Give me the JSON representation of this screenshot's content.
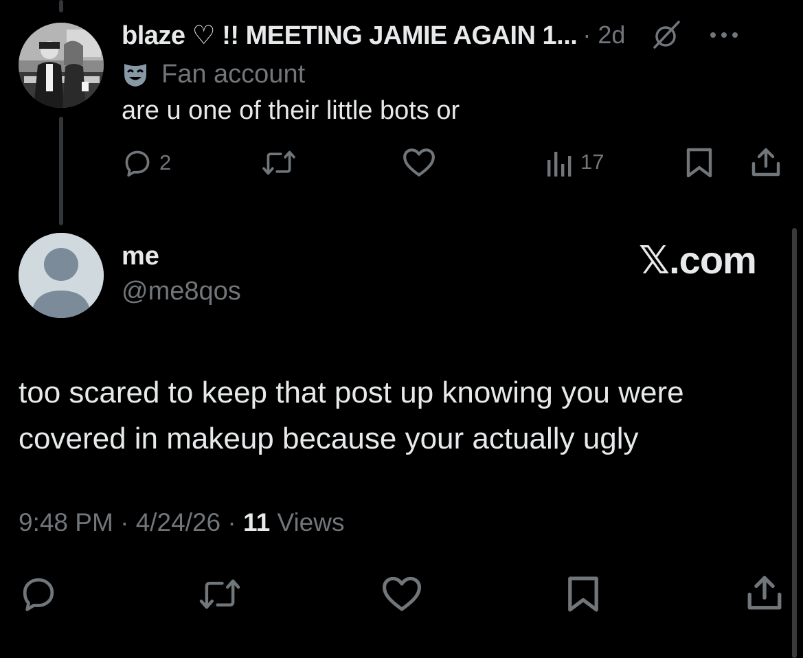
{
  "reply": {
    "display_name": "blaze ♡ !! MEETING JAMIE AGAIN 1...",
    "separator": "·",
    "time_ago": "2d",
    "label_icon": "theater-mask-icon",
    "label": "Fan account",
    "text": "are u one of their little bots or",
    "actions": {
      "reply_count": "2",
      "repost_count": "",
      "like_count": "",
      "views_count": "17"
    }
  },
  "post": {
    "display_name": "me",
    "handle": "@me8qos",
    "text": "too scared to keep that post up knowing you were covered in makeup because your actually ugly",
    "time": "9:48 PM",
    "date": "4/24/26",
    "views_count": "11",
    "views_label": "Views",
    "separator": "·"
  },
  "watermark": "𝕏.com",
  "colors": {
    "background": "#000000",
    "text_primary": "#e7e9ea",
    "text_secondary": "#71767b",
    "thread_line": "#333639",
    "default_avatar_bg": "#cfd9de",
    "default_avatar_fg": "#7b8b99"
  }
}
